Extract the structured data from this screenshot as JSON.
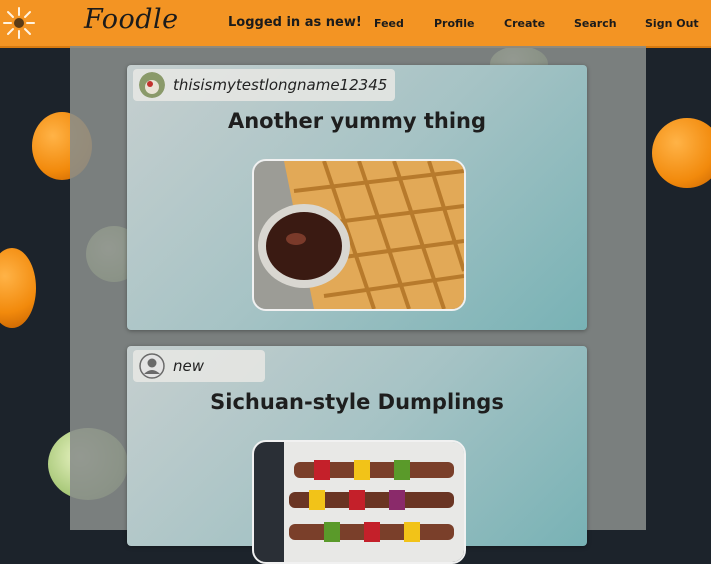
{
  "app": {
    "logo_text": "Foodle"
  },
  "header": {
    "status": "Logged in as new!",
    "nav": [
      {
        "label": "Feed"
      },
      {
        "label": "Profile"
      },
      {
        "label": "Create"
      },
      {
        "label": "Search"
      },
      {
        "label": "Sign Out"
      }
    ]
  },
  "feed": {
    "posts": [
      {
        "author": "thisismytestlongname12345",
        "title": "Another yummy thing",
        "photo": "waffles-with-dip-photo"
      },
      {
        "author": "new",
        "title": "Sichuan-style Dumplings",
        "photo": "skewers-photo"
      }
    ]
  },
  "colors": {
    "header": "#f39423",
    "card_start": "#c6cfcf",
    "card_end": "#78b2b5"
  }
}
